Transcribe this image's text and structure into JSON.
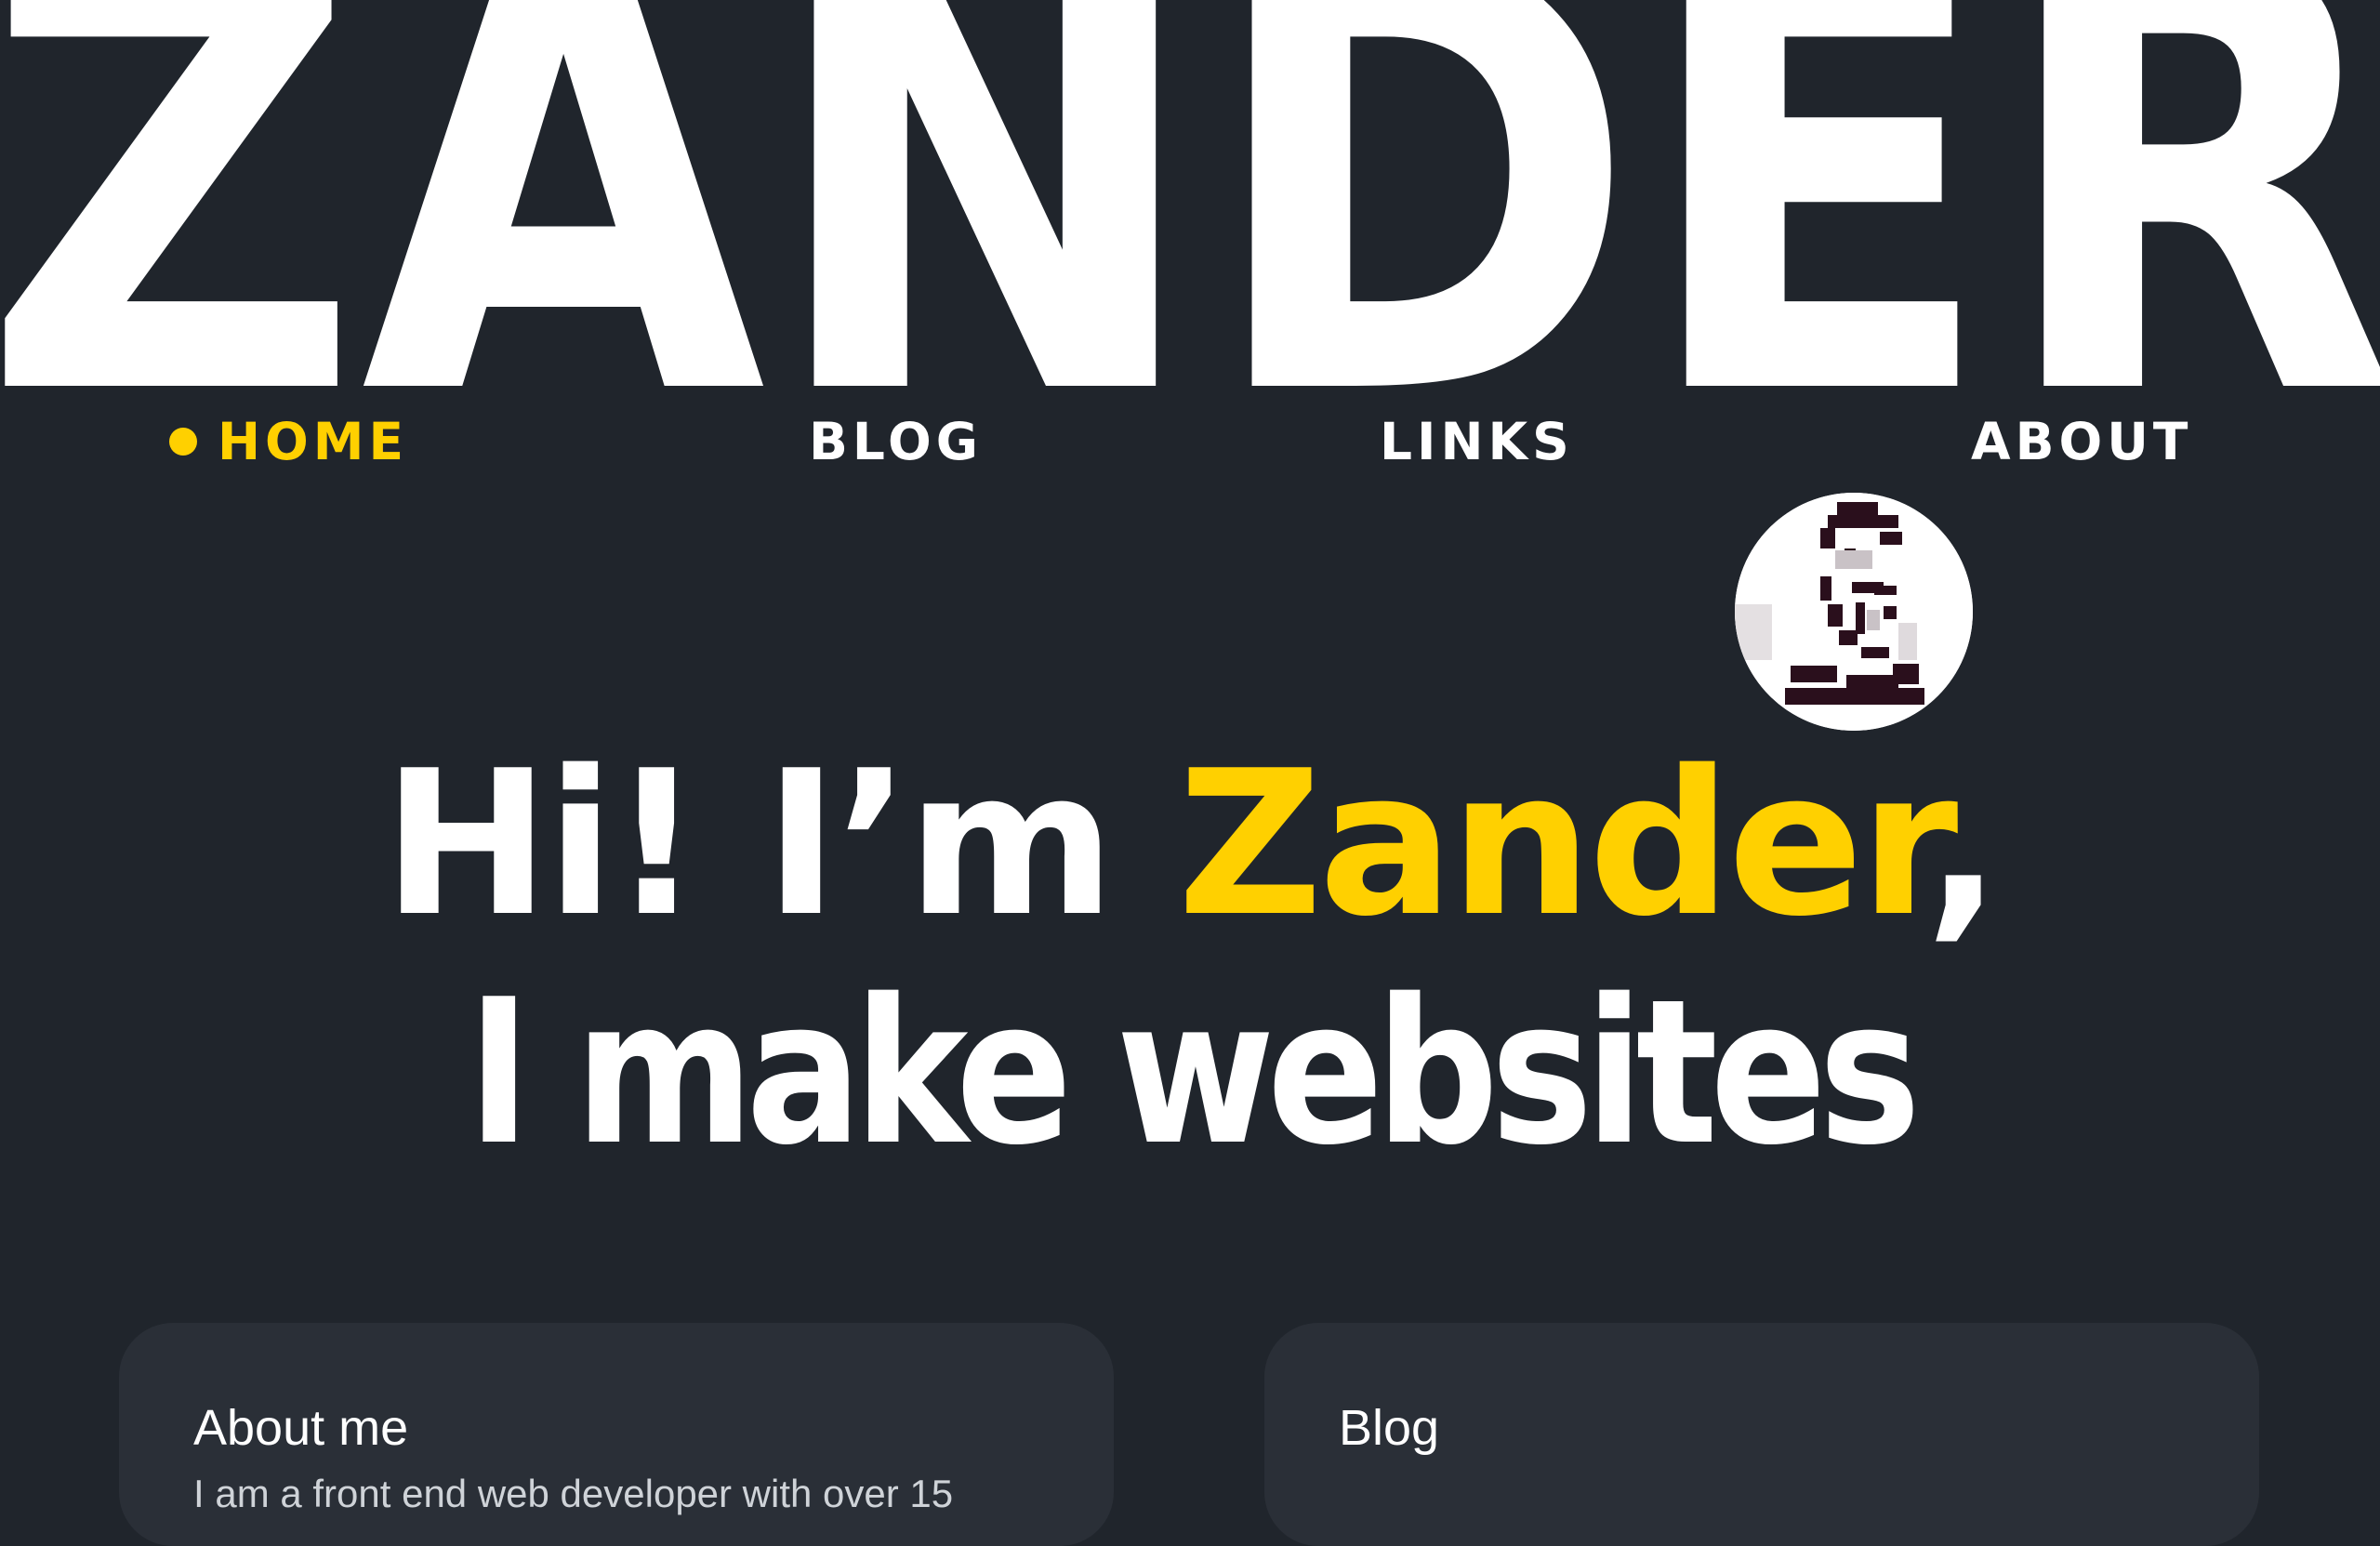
{
  "banner": {
    "text": "ZANDER"
  },
  "nav": {
    "items": [
      {
        "label": "HOME",
        "active": true
      },
      {
        "label": "BLOG",
        "active": false
      },
      {
        "label": "LINKS",
        "active": false
      },
      {
        "label": "ABOUT",
        "active": false
      }
    ]
  },
  "avatar": {
    "icon": "pixel-portrait-icon"
  },
  "hero": {
    "greeting": "Hi! I’m ",
    "name": "Zander",
    "comma": ",",
    "tagline": "I make websites"
  },
  "cards": [
    {
      "title": "About me",
      "text": "I am a front end web developer with over 15"
    },
    {
      "title": "Blog",
      "text": ""
    }
  ],
  "colors": {
    "background": "#20252c",
    "accent": "#ffd000",
    "card": "#2a2f37",
    "text": "#ffffff"
  }
}
